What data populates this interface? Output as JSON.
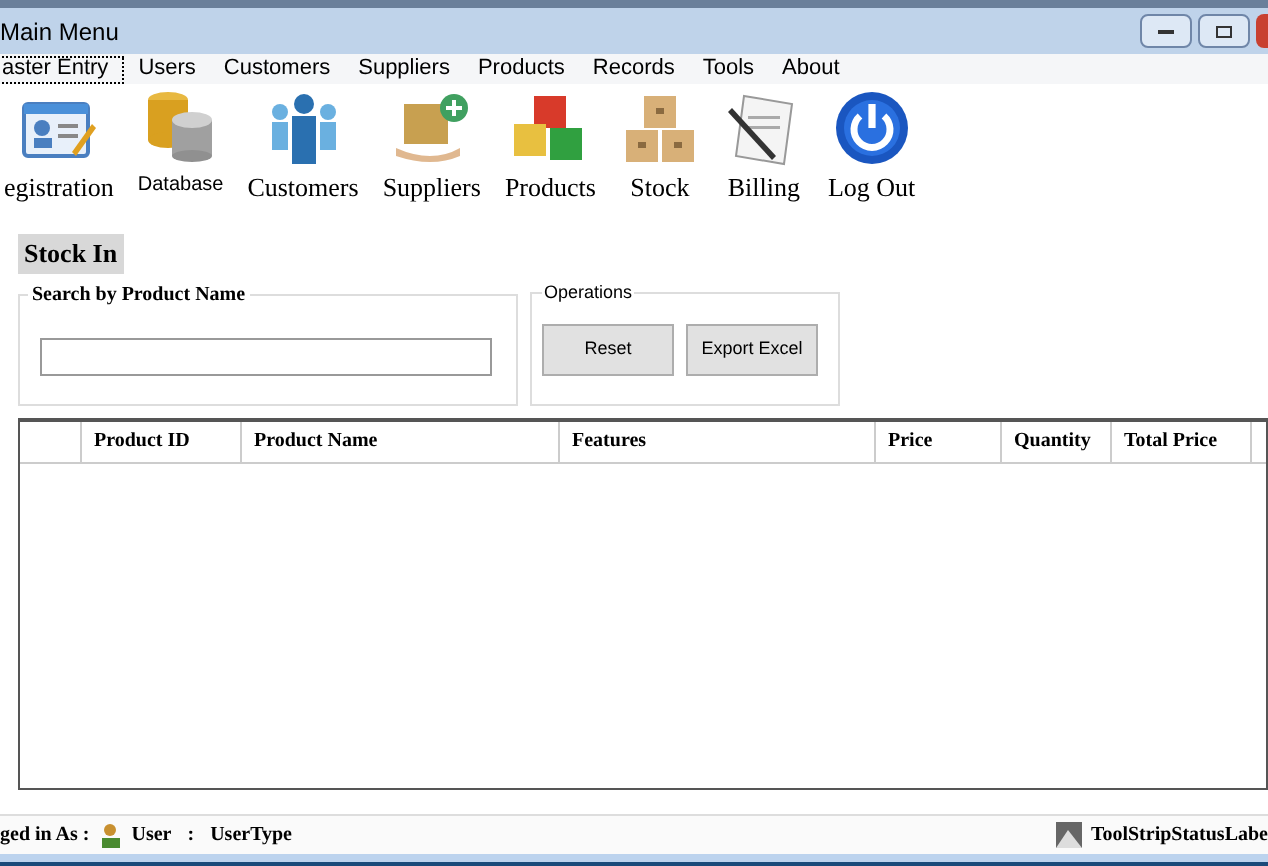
{
  "window": {
    "title": "Main Menu"
  },
  "menu": [
    {
      "label": "aster Entry",
      "selected": true
    },
    {
      "label": "Users",
      "selected": false
    },
    {
      "label": "Customers",
      "selected": false
    },
    {
      "label": "Suppliers",
      "selected": false
    },
    {
      "label": "Products",
      "selected": false
    },
    {
      "label": "Records",
      "selected": false
    },
    {
      "label": "Tools",
      "selected": false
    },
    {
      "label": "About",
      "selected": false
    }
  ],
  "toolbar": [
    {
      "label": "egistration",
      "kind": "large"
    },
    {
      "label": "Database",
      "kind": "small"
    },
    {
      "label": "Customers",
      "kind": "large"
    },
    {
      "label": "Suppliers",
      "kind": "large"
    },
    {
      "label": "Products",
      "kind": "large"
    },
    {
      "label": "Stock",
      "kind": "large"
    },
    {
      "label": "Billing",
      "kind": "large"
    },
    {
      "label": "Log Out",
      "kind": "large"
    }
  ],
  "heading": "Stock In",
  "search": {
    "title": "Search by Product Name"
  },
  "operations": {
    "title": "Operations",
    "buttons": [
      "Reset",
      "Export Excel"
    ]
  },
  "table": {
    "columns": [
      "Product ID",
      "Product Name",
      "Features",
      "Price",
      "Quantity",
      "Total Price"
    ]
  },
  "status_bar": {
    "prefix": "ged in As :",
    "user": "User",
    "separator": ":",
    "user_type": "UserType",
    "right": "ToolStripStatusLabe"
  }
}
